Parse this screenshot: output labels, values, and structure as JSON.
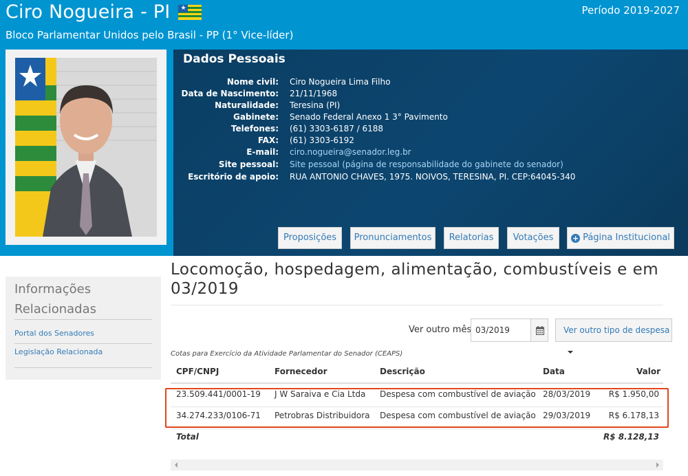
{
  "header": {
    "senator_name": "Ciro Nogueira - PI",
    "period": "Período 2019-2027",
    "party": "Bloco Parlamentar Unidos pelo Brasil - PP (1° Vice-líder)"
  },
  "dados": {
    "title": "Dados Pessoais",
    "rows": [
      {
        "label": "Nome civil:",
        "value": "Ciro Nogueira Lima Filho"
      },
      {
        "label": "Data de Nascimento:",
        "value": "21/11/1968"
      },
      {
        "label": "Naturalidade:",
        "value": "Teresina (PI)"
      },
      {
        "label": "Gabinete:",
        "value": "Senado Federal Anexo 1 3° Pavimento"
      },
      {
        "label": "Telefones:",
        "value": "(61) 3303-6187 / 6188"
      },
      {
        "label": "FAX:",
        "value": "(61) 3303-6192"
      },
      {
        "label": "E-mail:",
        "value": "ciro.nogueira@senador.leg.br"
      },
      {
        "label": "Site pessoal:",
        "value": "Site pessoal (página de responsabilidade do gabinete do senador)"
      },
      {
        "label": "Escritório de apoio:",
        "value": "RUA ANTONIO CHAVES, 1975. NOIVOS, TERESINA, PI. CEP:64045-340"
      }
    ]
  },
  "buttons": {
    "proposicoes": "Proposições",
    "pronunciamentos": "Pronunciamentos",
    "relatorias": "Relatorias",
    "votacoes": "Votações",
    "pagina": "Página Institucional"
  },
  "sidebar": {
    "title": "Informações Relacionadas",
    "links": [
      "Portal dos Senadores",
      "Legislação Relacionada"
    ]
  },
  "main": {
    "title": "Locomoção, hospedagem, alimentação, combustíveis e em 03/2019",
    "ver_outro_mes": "Ver outro mês:",
    "month_value": "03/2019",
    "tipo_despesa": "Ver outro tipo de despesa",
    "caption": "Cotas para Exercício da Atividade Parlamentar do Senador (CEAPS)"
  },
  "table": {
    "headers": [
      "CPF/CNPJ",
      "Fornecedor",
      "Descrição",
      "Data",
      "Valor"
    ],
    "rows": [
      [
        "23.509.441/0001-19",
        "J W Saraiva e Cia Ltda",
        "Despesa com combustível de aviação",
        "28/03/2019",
        "R$ 1.950,00"
      ],
      [
        "34.274.233/0106-71",
        "Petrobras Distribuidora",
        "Despesa com combustível de aviação",
        "29/03/2019",
        "R$ 6.178,13"
      ]
    ],
    "total_label": "Total",
    "total_value": "R$ 8.128,13"
  },
  "colors": {
    "header_blue": "#0094d1",
    "panel_dark": "#0c4670",
    "link_blue": "#337ab7",
    "highlight": "#e2461b"
  }
}
